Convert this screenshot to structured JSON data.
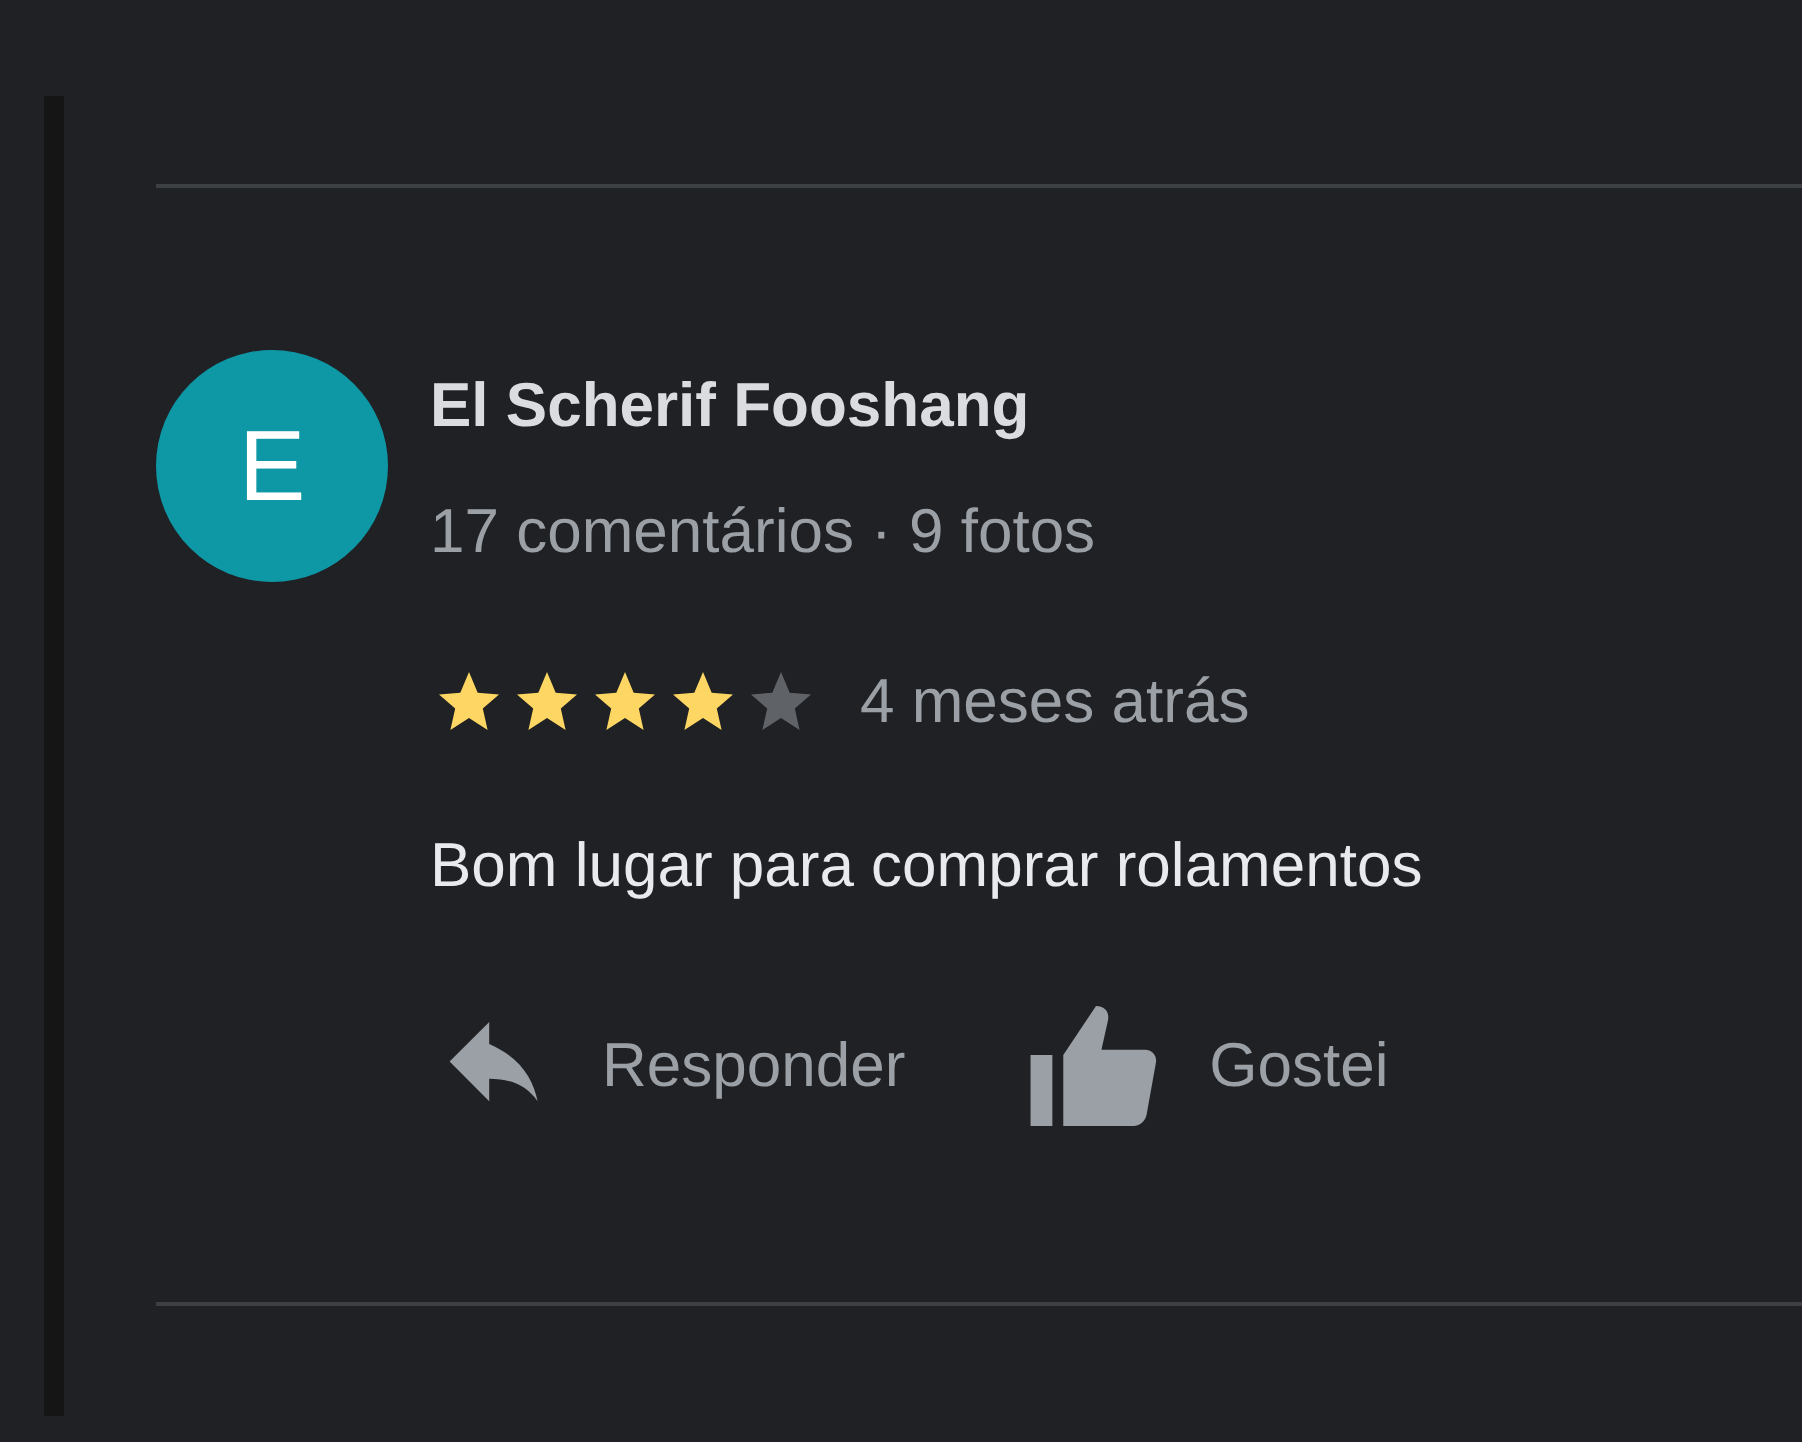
{
  "review": {
    "avatar_letter": "E",
    "author": "El Scherif Fooshang",
    "meta": "17 comentários · 9 fotos",
    "stars": 4,
    "time": "4 meses atrás",
    "text": "Bom lugar para comprar rolamentos",
    "actions": [
      {
        "kind": "reply",
        "label": "Responder"
      },
      {
        "kind": "like",
        "label": "Gostei"
      }
    ]
  }
}
